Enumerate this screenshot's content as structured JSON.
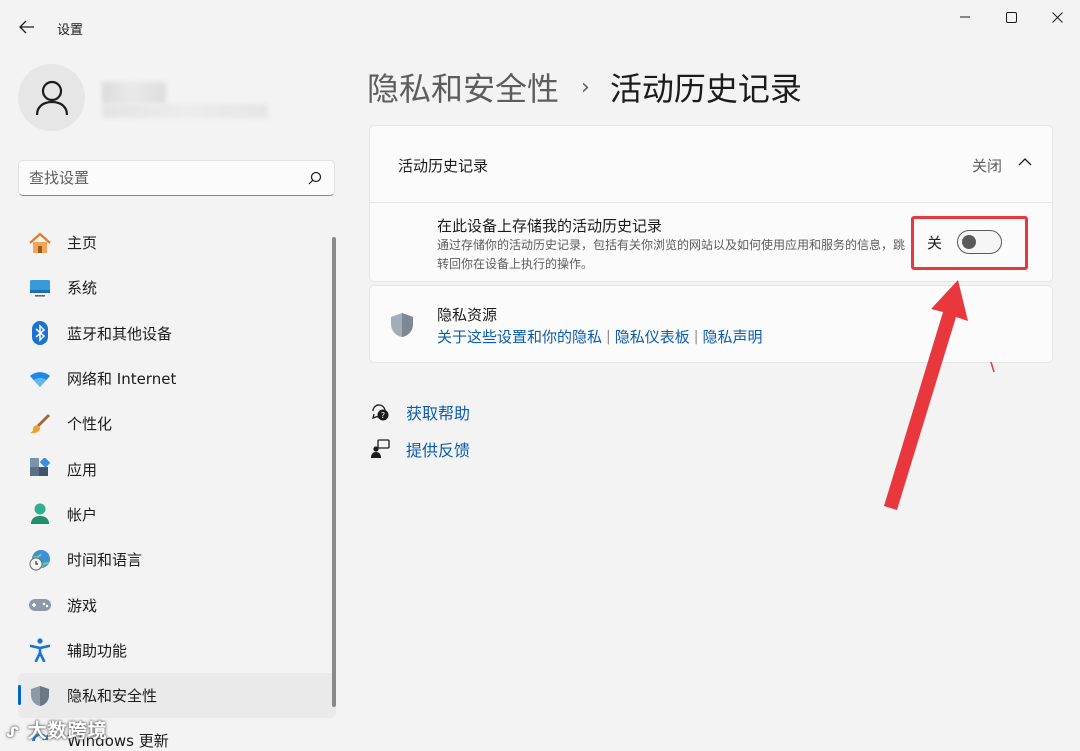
{
  "window": {
    "title": "设置"
  },
  "search": {
    "placeholder": "查找设置"
  },
  "sidebar": {
    "items": [
      {
        "label": "主页"
      },
      {
        "label": "系统"
      },
      {
        "label": "蓝牙和其他设备"
      },
      {
        "label": "网络和 Internet"
      },
      {
        "label": "个性化"
      },
      {
        "label": "应用"
      },
      {
        "label": "帐户"
      },
      {
        "label": "时间和语言"
      },
      {
        "label": "游戏"
      },
      {
        "label": "辅助功能"
      },
      {
        "label": "隐私和安全性"
      },
      {
        "label": "Windows 更新"
      }
    ],
    "active": "隐私和安全性"
  },
  "breadcrumb": {
    "parent": "隐私和安全性",
    "separator": "›",
    "current": "活动历史记录"
  },
  "activity_card": {
    "title": "活动历史记录",
    "status": "关闭",
    "option_title": "在此设备上存储我的活动历史记录",
    "option_desc": "通过存储你的活动历史记录，包括有关你浏览的网站以及如何使用应用和服务的信息，跳转回你在设备上执行的操作。",
    "toggle_label": "关",
    "toggle_state": "off"
  },
  "privacy_resources": {
    "title": "隐私资源",
    "links": [
      "关于这些设置和你的隐私",
      "隐私仪表板",
      "隐私声明"
    ]
  },
  "help": {
    "get_help": "获取帮助",
    "feedback": "提供反馈"
  },
  "watermark": "大数跨境",
  "colors": {
    "accent": "#0067c0",
    "link": "#0b5cad",
    "highlight": "#e8383d"
  }
}
